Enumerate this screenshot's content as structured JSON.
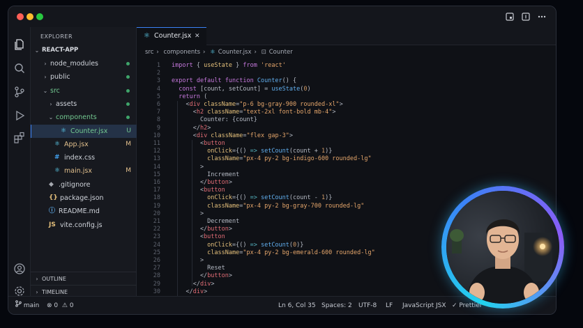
{
  "window": {
    "controls": [
      "close",
      "minimize",
      "maximize"
    ]
  },
  "titlebar": {
    "icons": [
      "layout-icon",
      "panel-icon",
      "more-icon"
    ]
  },
  "activity_bar": {
    "icons": [
      "files-icon",
      "search-icon",
      "source-control-icon",
      "run-debug-icon",
      "extensions-icon"
    ],
    "bottom_icons": [
      "account-icon",
      "settings-icon"
    ]
  },
  "sidebar": {
    "title": "EXPLORER",
    "project": "REACT-APP",
    "items": [
      {
        "label": "node_modules",
        "type": "folder",
        "expanded": false,
        "depth": 1,
        "status": "dot"
      },
      {
        "label": "public",
        "type": "folder",
        "expanded": false,
        "depth": 1,
        "status": "dot"
      },
      {
        "label": "src",
        "type": "folder",
        "expanded": true,
        "depth": 1,
        "status": "dot"
      },
      {
        "label": "assets",
        "type": "folder",
        "expanded": false,
        "depth": 2,
        "status": "dot"
      },
      {
        "label": "components",
        "type": "folder",
        "expanded": true,
        "depth": 2,
        "status": "dot"
      },
      {
        "label": "Counter.jsx",
        "type": "react",
        "depth": 3,
        "status": "U",
        "active": true
      },
      {
        "label": "App.jsx",
        "type": "react",
        "depth": 2,
        "status": "M"
      },
      {
        "label": "index.css",
        "type": "css",
        "depth": 2,
        "status": ""
      },
      {
        "label": "main.jsx",
        "type": "react",
        "depth": 2,
        "status": "M"
      },
      {
        "label": ".gitignore",
        "type": "git",
        "depth": 1,
        "status": ""
      },
      {
        "label": "package.json",
        "type": "json",
        "depth": 1,
        "status": ""
      },
      {
        "label": "README.md",
        "type": "info",
        "depth": 1,
        "status": ""
      },
      {
        "label": "vite.config.js",
        "type": "js",
        "depth": 1,
        "status": ""
      }
    ],
    "outline": "OUTLINE",
    "timeline": "TIMELINE"
  },
  "editor": {
    "tab": {
      "label": "Counter.jsx",
      "close": "✕"
    },
    "breadcrumb": [
      "src",
      "components",
      "Counter.jsx",
      "Counter"
    ],
    "lines": [
      [
        [
          "k",
          "import"
        ],
        [
          "p",
          " { "
        ],
        [
          "a",
          "useState"
        ],
        [
          "p",
          " } "
        ],
        [
          "k",
          "from"
        ],
        [
          "s",
          " 'react'"
        ]
      ],
      [],
      [
        [
          "k",
          "export default function "
        ],
        [
          "f",
          "Counter"
        ],
        [
          "p",
          "() {"
        ]
      ],
      [
        [
          "p",
          "  "
        ],
        [
          "k",
          "const"
        ],
        [
          "p",
          " [count, setCount] = "
        ],
        [
          "f",
          "useState"
        ],
        [
          "p",
          "("
        ],
        [
          "n",
          "0"
        ],
        [
          "p",
          ")"
        ]
      ],
      [
        [
          "p",
          "  "
        ],
        [
          "k",
          "return"
        ],
        [
          "p",
          " ("
        ]
      ],
      [
        [
          "p",
          "    <"
        ],
        [
          "t",
          "div"
        ],
        [
          "a",
          " className"
        ],
        [
          "p",
          "="
        ],
        [
          "s",
          "\"p-6 bg-gray-900 rounded-xl\""
        ],
        [
          "p",
          ">"
        ]
      ],
      [
        [
          "p",
          "      <"
        ],
        [
          "t",
          "h2"
        ],
        [
          "a",
          " className"
        ],
        [
          "p",
          "="
        ],
        [
          "s",
          "\"text-2xl font-bold mb-4\""
        ],
        [
          "p",
          ">"
        ]
      ],
      [
        [
          "p",
          "        Counter: {count}"
        ]
      ],
      [
        [
          "p",
          "      </"
        ],
        [
          "t",
          "h2"
        ],
        [
          "p",
          ">"
        ]
      ],
      [
        [
          "p",
          "      <"
        ],
        [
          "t",
          "div"
        ],
        [
          "a",
          " className"
        ],
        [
          "p",
          "="
        ],
        [
          "s",
          "\"flex gap-3\""
        ],
        [
          "p",
          ">"
        ]
      ],
      [
        [
          "p",
          "        <"
        ],
        [
          "t",
          "button"
        ]
      ],
      [
        [
          "a",
          "          onClick"
        ],
        [
          "p",
          "={() "
        ],
        [
          "g",
          "=>"
        ],
        [
          "f",
          " setCount"
        ],
        [
          "p",
          "(count + "
        ],
        [
          "n",
          "1"
        ],
        [
          "p",
          ")}"
        ]
      ],
      [
        [
          "a",
          "          className"
        ],
        [
          "p",
          "="
        ],
        [
          "s",
          "\"px-4 py-2 bg-indigo-600 rounded-lg\""
        ]
      ],
      [
        [
          "p",
          "        >"
        ]
      ],
      [
        [
          "p",
          "          Increment"
        ]
      ],
      [
        [
          "p",
          "        </"
        ],
        [
          "t",
          "button"
        ],
        [
          "p",
          ">"
        ]
      ],
      [
        [
          "p",
          "        <"
        ],
        [
          "t",
          "button"
        ]
      ],
      [
        [
          "a",
          "          onClick"
        ],
        [
          "p",
          "={() "
        ],
        [
          "g",
          "=>"
        ],
        [
          "f",
          " setCount"
        ],
        [
          "p",
          "(count - "
        ],
        [
          "n",
          "1"
        ],
        [
          "p",
          ")}"
        ]
      ],
      [
        [
          "a",
          "          className"
        ],
        [
          "p",
          "="
        ],
        [
          "s",
          "\"px-4 py-2 bg-gray-700 rounded-lg\""
        ]
      ],
      [
        [
          "p",
          "        >"
        ]
      ],
      [
        [
          "p",
          "          Decrement"
        ]
      ],
      [
        [
          "p",
          "        </"
        ],
        [
          "t",
          "button"
        ],
        [
          "p",
          ">"
        ]
      ],
      [
        [
          "p",
          "        <"
        ],
        [
          "t",
          "button"
        ]
      ],
      [
        [
          "a",
          "          onClick"
        ],
        [
          "p",
          "={() "
        ],
        [
          "g",
          "=>"
        ],
        [
          "f",
          " setCount"
        ],
        [
          "p",
          "("
        ],
        [
          "n",
          "0"
        ],
        [
          "p",
          ")}"
        ]
      ],
      [
        [
          "a",
          "          className"
        ],
        [
          "p",
          "="
        ],
        [
          "s",
          "\"px-4 py-2 bg-emerald-600 rounded-lg\""
        ]
      ],
      [
        [
          "p",
          "        >"
        ]
      ],
      [
        [
          "p",
          "          Reset"
        ]
      ],
      [
        [
          "p",
          "        </"
        ],
        [
          "t",
          "button"
        ],
        [
          "p",
          ">"
        ]
      ],
      [
        [
          "p",
          "      </"
        ],
        [
          "t",
          "div"
        ],
        [
          "p",
          ">"
        ]
      ],
      [
        [
          "p",
          "    </"
        ],
        [
          "t",
          "div"
        ],
        [
          "p",
          ">"
        ]
      ],
      [
        [
          "p",
          "  )"
        ]
      ],
      [
        [
          "p",
          "}"
        ]
      ]
    ]
  },
  "statusbar": {
    "branch": "main",
    "errors": "0",
    "warnings": "0",
    "cursor": "Ln 6, Col 35",
    "spaces": "Spaces: 2",
    "encoding": "UTF-8",
    "eol": "LF",
    "language": "JavaScript JSX",
    "formatter": "Prettier"
  },
  "colors": {
    "accent": "#3b82f6",
    "added": "#3fa46a",
    "modified": "#e2c08d",
    "untracked": "#73c991"
  }
}
